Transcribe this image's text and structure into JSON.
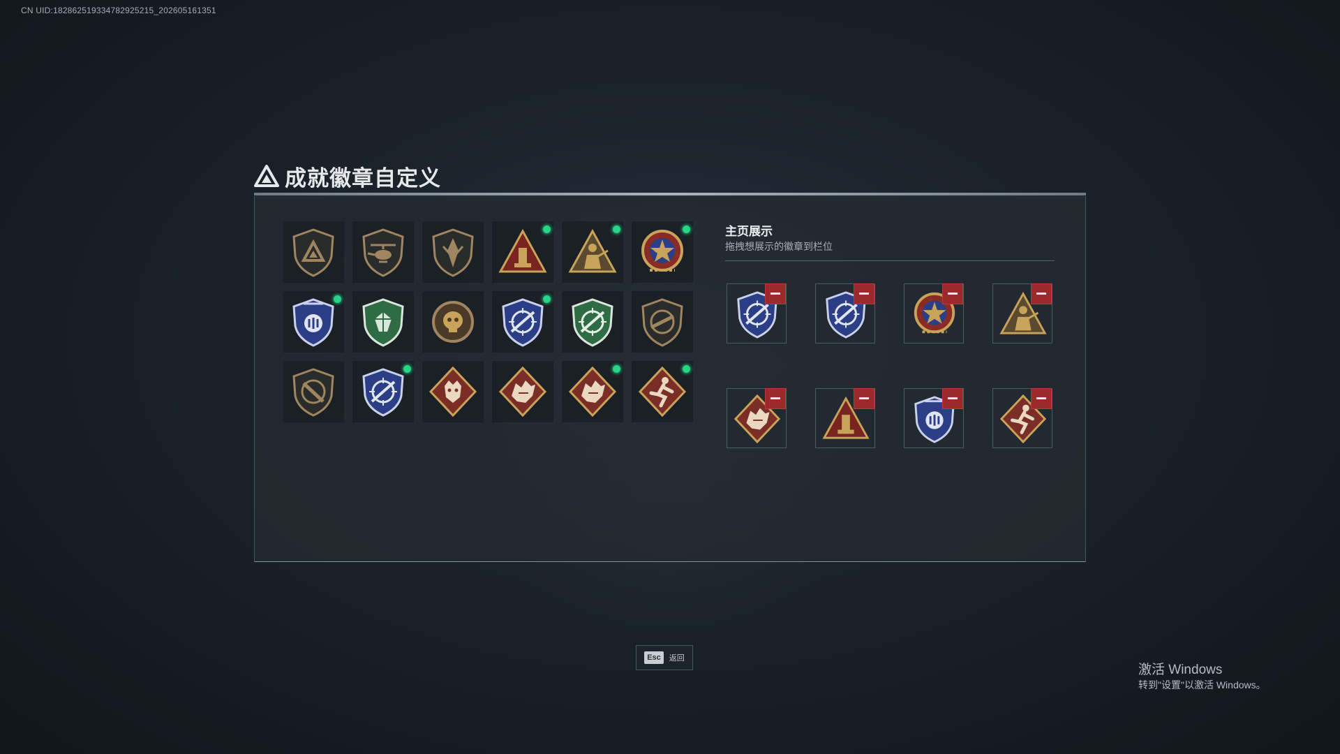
{
  "uid_text": "CN UID:182862519334782925215_202605161351",
  "title": "成就徽章自定义",
  "colors": {
    "accent_green": "#29d388",
    "remove_red": "#9c2a2d",
    "gold": "#c9a35a",
    "bronze": "#a08660",
    "navy": "#2c3f86",
    "green": "#2f6b45",
    "crimson": "#7a2e26"
  },
  "badges": [
    {
      "icon": "triangle-shield-badge-icon",
      "new": false
    },
    {
      "icon": "helicopter-shield-badge-icon",
      "new": false
    },
    {
      "icon": "blade-shield-badge-icon",
      "new": false
    },
    {
      "icon": "gold-triangle-tower-badge-icon",
      "new": true
    },
    {
      "icon": "gold-triangle-soldier-badge-icon",
      "new": true
    },
    {
      "icon": "star-medal-badge-icon",
      "new": true
    },
    {
      "icon": "blue-police-shield-badge-icon",
      "new": true
    },
    {
      "icon": "green-gem-shield-badge-icon",
      "new": false
    },
    {
      "icon": "bronze-skull-medal-badge-icon",
      "new": false
    },
    {
      "icon": "blue-crosshair-shield-badge-icon",
      "new": true
    },
    {
      "icon": "green-crosshair-shield-badge-icon",
      "new": false
    },
    {
      "icon": "bronze-rifle-shield-badge-icon",
      "new": false
    },
    {
      "icon": "bronze-crossed-shield-badge-icon",
      "new": false
    },
    {
      "icon": "blue-crosshair-shield-badge-icon",
      "new": true
    },
    {
      "icon": "red-tiger-diamond-badge-icon",
      "new": false
    },
    {
      "icon": "red-dragon-diamond-badge-icon",
      "new": false
    },
    {
      "icon": "red-dragon-diamond-badge-icon",
      "new": true
    },
    {
      "icon": "red-runner-diamond-badge-icon",
      "new": true
    }
  ],
  "display": {
    "title": "主页展示",
    "subtitle": "拖拽想展示的徽章到栏位",
    "slots": [
      {
        "icon": "blue-crosshair-shield-badge-icon"
      },
      {
        "icon": "blue-crosshair-shield-badge-icon"
      },
      {
        "icon": "star-medal-badge-icon"
      },
      {
        "icon": "gold-triangle-soldier-badge-icon"
      },
      {
        "icon": "red-dragon-diamond-badge-icon"
      },
      {
        "icon": "gold-triangle-tower-badge-icon"
      },
      {
        "icon": "blue-police-shield-badge-icon"
      },
      {
        "icon": "red-runner-diamond-badge-icon"
      }
    ]
  },
  "esc": {
    "key": "Esc",
    "label": "返回"
  },
  "windows": {
    "line1": "激活 Windows",
    "line2": "转到\"设置\"以激活 Windows。"
  }
}
